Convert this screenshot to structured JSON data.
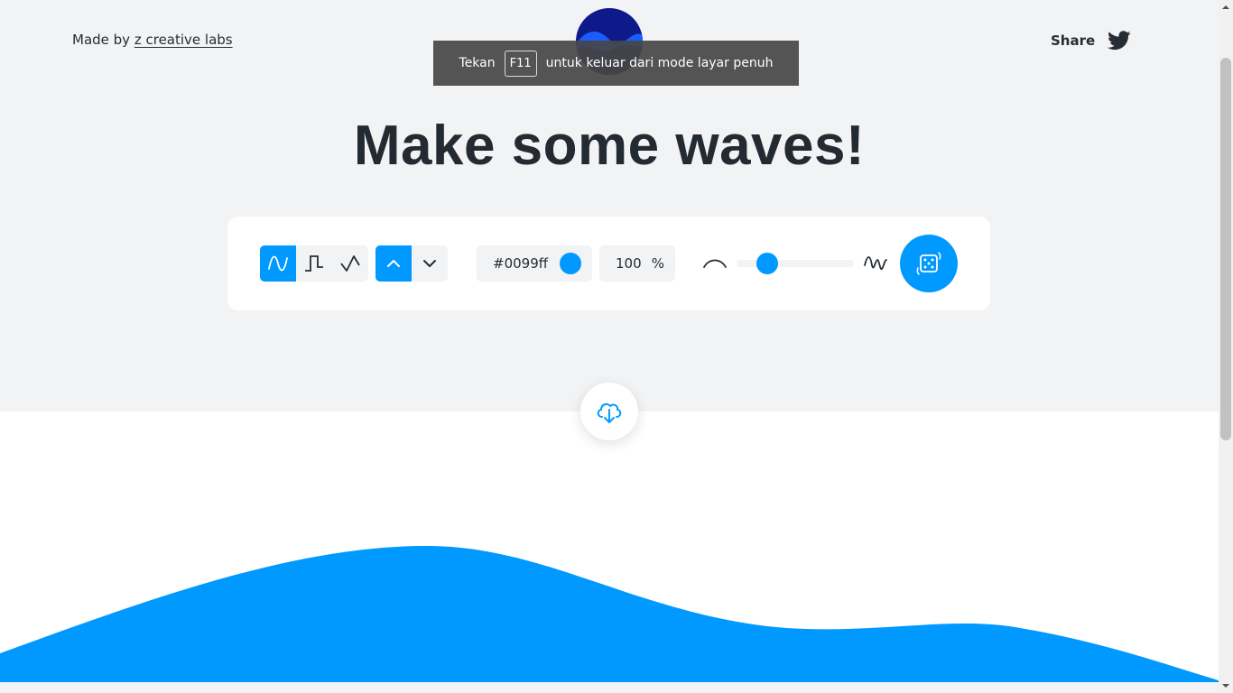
{
  "header": {
    "made_by_prefix": "Made by",
    "made_by_link": "z creative labs",
    "share_label": "Share"
  },
  "fullscreen_toast": {
    "before": "Tekan",
    "key": "F11",
    "after": "untuk keluar dari mode layar penuh"
  },
  "headline": "Make some waves!",
  "controls": {
    "wave_types": [
      "sine-wave-icon",
      "square-wave-icon",
      "peak-wave-icon"
    ],
    "active_wave_type": "sine",
    "direction_options": [
      "chevron-up-icon",
      "chevron-down-icon"
    ],
    "active_direction": "up",
    "color_value": "#0099ff",
    "opacity_value": "100",
    "opacity_unit": "%",
    "complexity_level": 0.17,
    "randomize_icon": "dice-icon"
  },
  "colors": {
    "accent": "#0099ff",
    "background": "#f2f3f4",
    "text": "#262d33"
  },
  "download_icon": "cloud-download-icon"
}
